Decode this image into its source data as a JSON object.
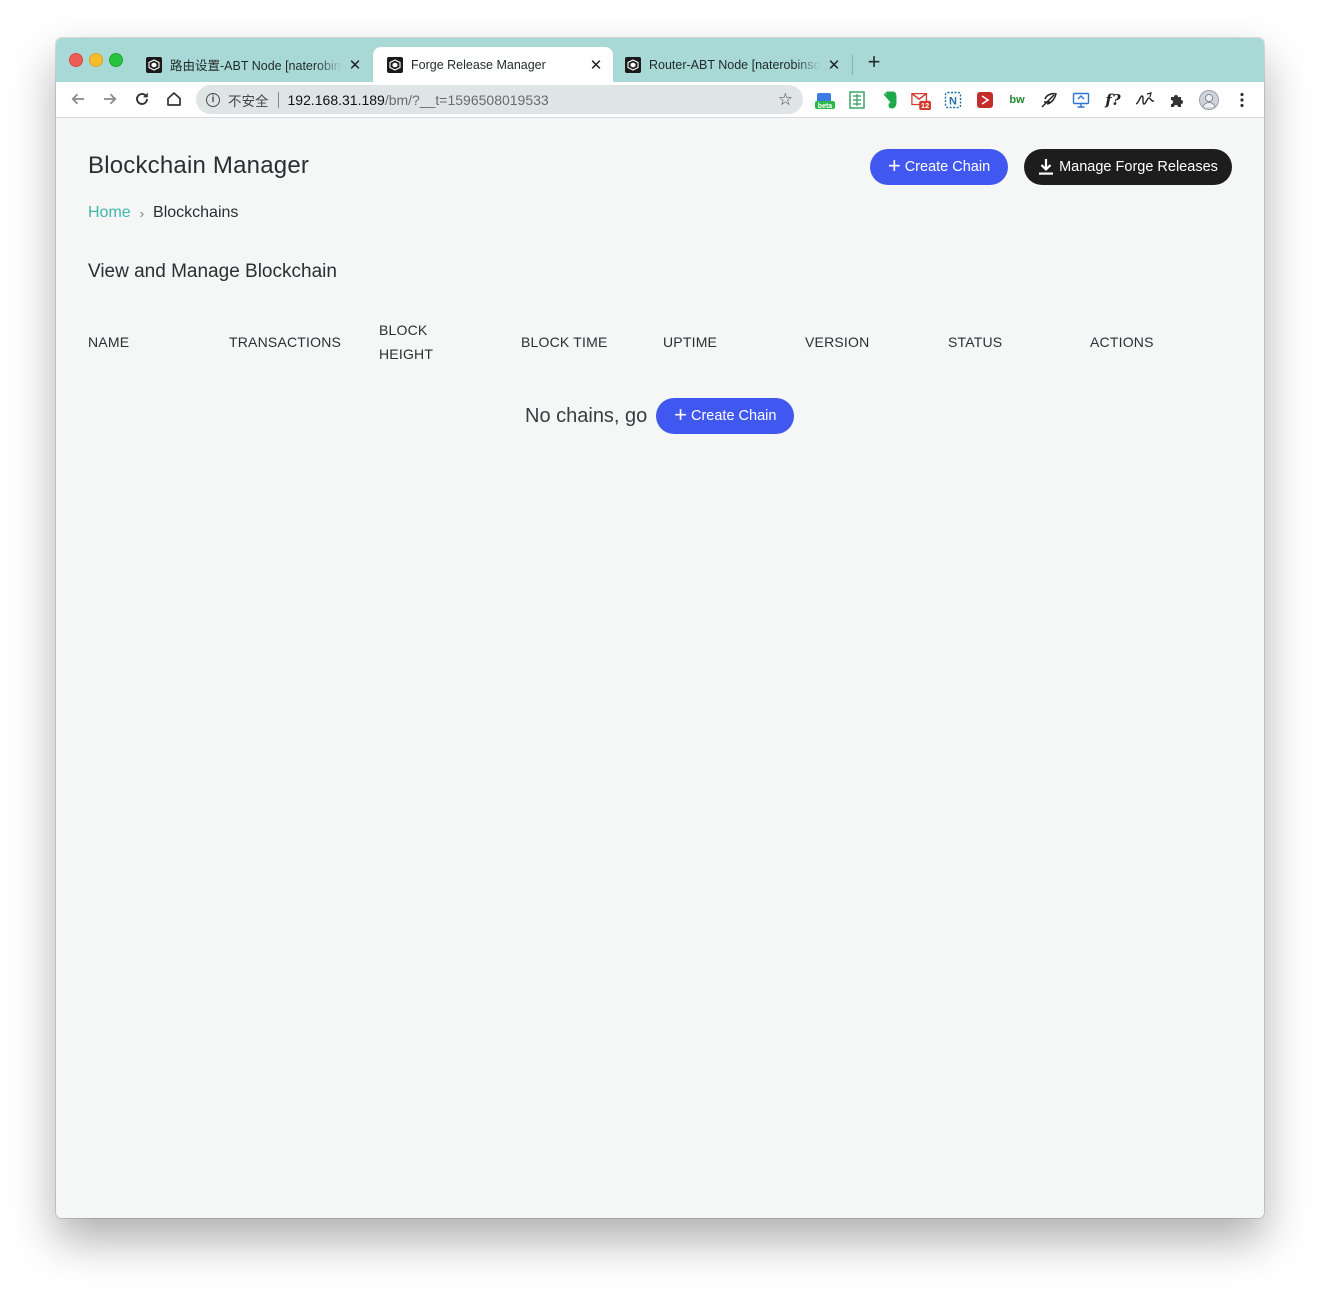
{
  "browser": {
    "tabs": [
      {
        "title": "路由设置-ABT Node [naterobinson]",
        "active": false
      },
      {
        "title": "Forge Release Manager",
        "active": true
      },
      {
        "title": "Router-ABT Node [naterobinson]",
        "active": false
      }
    ],
    "address": {
      "security_label": "不安全",
      "host": "192.168.31.189",
      "path": "/bm/?__t=1596508019533"
    },
    "extensions": [
      {
        "icon": "wallet-beta-extension-icon",
        "badge": "beta"
      },
      {
        "icon": "sheets-extension-icon"
      },
      {
        "icon": "evernote-extension-icon"
      },
      {
        "icon": "gmail-extension-icon",
        "badge": "12"
      },
      {
        "icon": "notion-extension-icon"
      },
      {
        "icon": "red-extension-icon"
      },
      {
        "icon": "bw-extension-icon",
        "text": "bw"
      },
      {
        "icon": "feather-extension-icon"
      },
      {
        "icon": "screen-extension-icon"
      },
      {
        "icon": "formula-extension-icon",
        "text": "f?"
      },
      {
        "icon": "signature-extension-icon"
      },
      {
        "icon": "puzzle-extensions-icon"
      },
      {
        "icon": "profile-avatar-icon"
      }
    ]
  },
  "header": {
    "title": "Blockchain Manager",
    "create_label": "Create Chain",
    "manage_label": "Manage Forge Releases"
  },
  "breadcrumb": {
    "home": "Home",
    "separator": "›",
    "current": "Blockchains"
  },
  "section": {
    "title": "View and Manage Blockchain"
  },
  "table": {
    "columns": [
      "NAME",
      "TRANSACTIONS",
      "BLOCK HEIGHT",
      "BLOCK TIME",
      "UPTIME",
      "VERSION",
      "STATUS",
      "ACTIONS"
    ],
    "rows": []
  },
  "empty_state": {
    "message": "No chains, go",
    "button_label": "Create Chain"
  },
  "colors": {
    "primary": "#4158f0",
    "dark_button": "#1d1d1d",
    "link": "#3fb6ac",
    "tabstrip": "#a9d9d6",
    "page_bg": "#f5f6f6"
  }
}
